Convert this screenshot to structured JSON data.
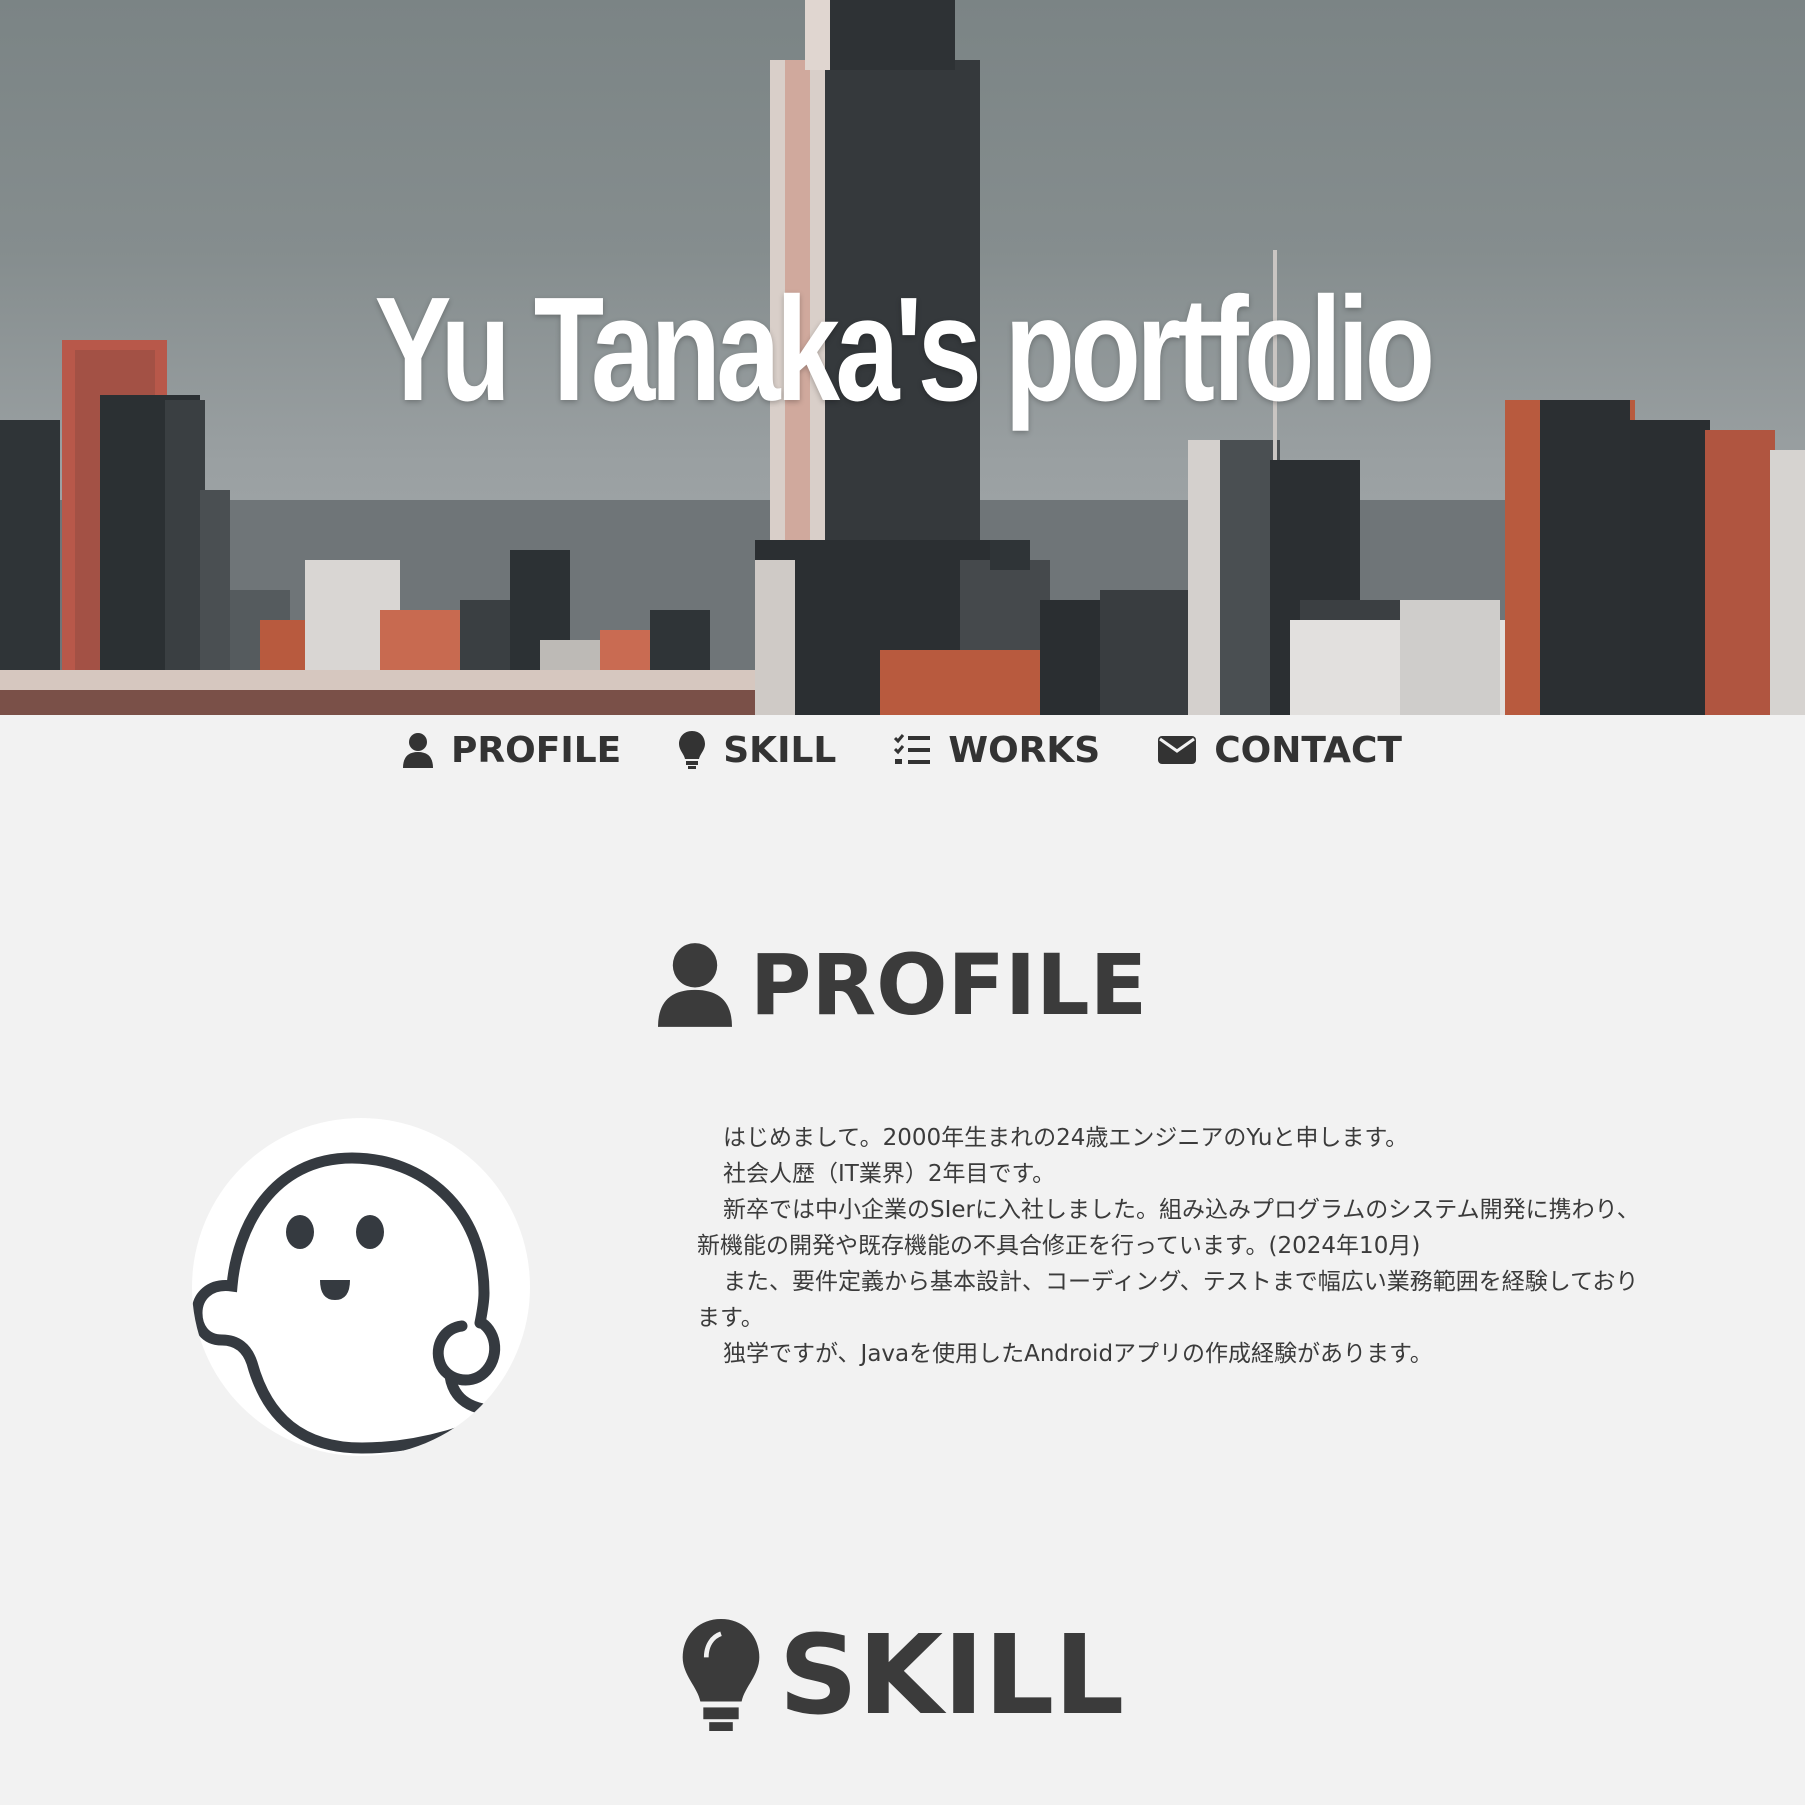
{
  "hero": {
    "title": "Yu Tanaka's portfolio"
  },
  "nav": {
    "items": [
      {
        "label": "PROFILE",
        "icon": "user-icon"
      },
      {
        "label": "SKILL",
        "icon": "lightbulb-icon"
      },
      {
        "label": "WORKS",
        "icon": "list-check-icon"
      },
      {
        "label": "CONTACT",
        "icon": "envelope-icon"
      }
    ]
  },
  "profile": {
    "heading": "PROFILE",
    "avatar_icon": "ghost-avatar-icon",
    "paragraphs": [
      "はじめまして。2000年生まれの24歳エンジニアのYuと申します。",
      "社会人歴（IT業界）2年目です。",
      "新卒では中小企業のSIerに入社しました。組み込みプログラムのシステム開発に携わり、新機能の開発や既存機能の不具合修正を行っています。(2024年10月)",
      "また、要件定義から基本設計、コーディング、テストまで幅広い業務範囲を経験しております。",
      "独学ですが、Javaを使用したAndroidアプリの作成経験があります。"
    ]
  },
  "skill": {
    "heading": "SKILL"
  },
  "colors": {
    "background": "#f2f2f2",
    "text": "#3b3b3b",
    "hero_title": "#ffffff",
    "brick_accent": "#b85a3e"
  }
}
